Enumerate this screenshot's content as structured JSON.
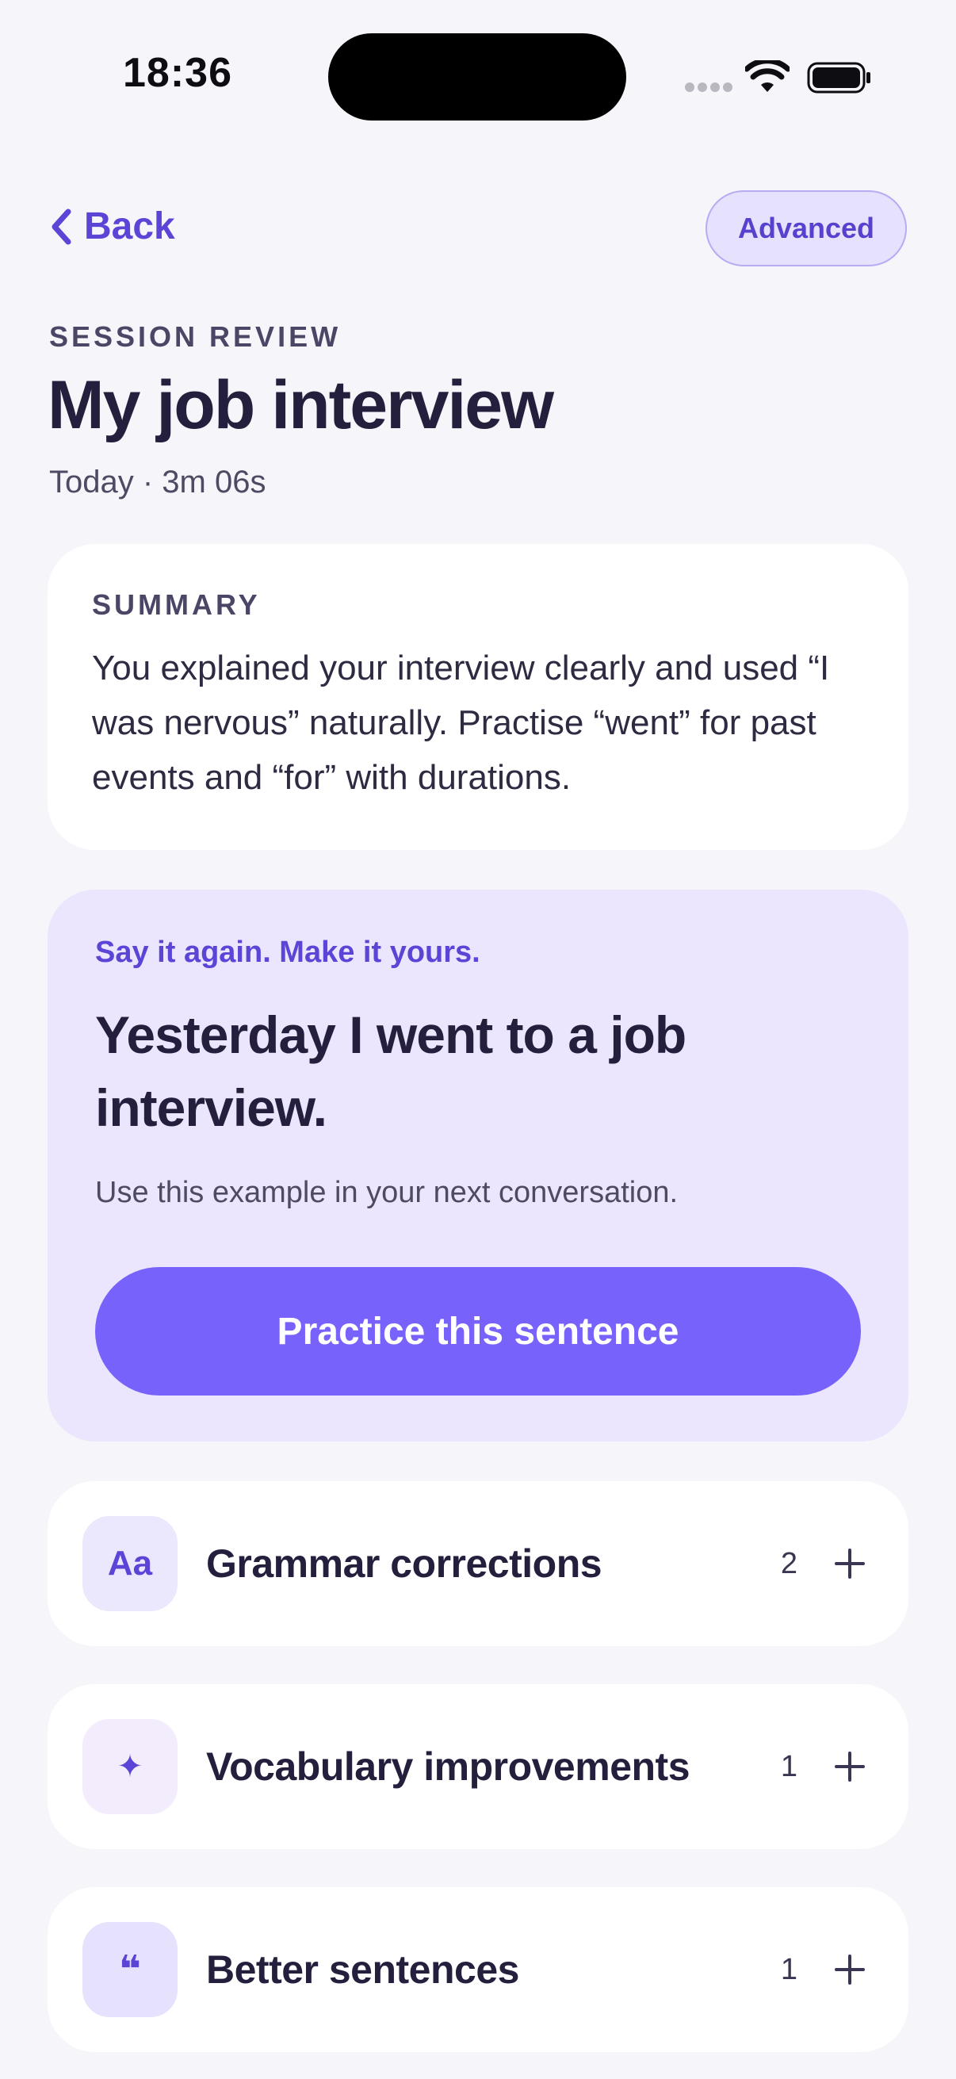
{
  "status_bar": {
    "time": "18:36"
  },
  "nav": {
    "back_label": "Back",
    "level_label": "Advanced"
  },
  "header": {
    "eyebrow": "SESSION REVIEW",
    "title": "My job interview",
    "meta": "Today · 3m 06s"
  },
  "summary": {
    "label": "SUMMARY",
    "text": "You explained your interview clearly and used “I was nervous” naturally. Practise “went” for past events and “for” with durations."
  },
  "practice": {
    "kicker": "Say it again. Make it yours.",
    "sentence": "Yesterday I went to a job interview.",
    "hint": "Use this example in your next conversation.",
    "button_label": "Practice this sentence"
  },
  "sections": [
    {
      "icon": "grammar-icon",
      "icon_text": "Aa",
      "icon_bg": "#ebe7fd",
      "label": "Grammar corrections",
      "count": "2"
    },
    {
      "icon": "sparkle-icon",
      "icon_text": "✦",
      "icon_bg": "#f3ecfd",
      "label": "Vocabulary improvements",
      "count": "1"
    },
    {
      "icon": "quote-icon",
      "icon_text": "❝",
      "icon_bg": "#e6e2fd",
      "label": "Better sentences",
      "count": "1"
    }
  ],
  "colors": {
    "accent": "#5b45d6",
    "button": "#7762fb",
    "practice_bg": "#ebe6fd",
    "page_bg": "#f6f5fa"
  }
}
